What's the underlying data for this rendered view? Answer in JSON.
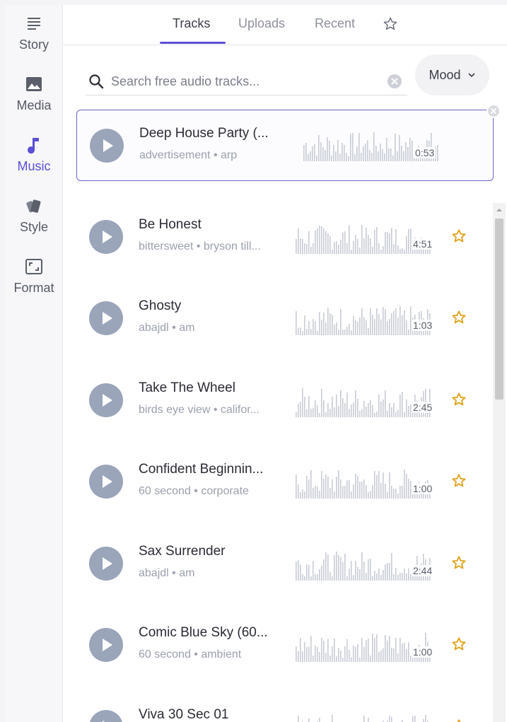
{
  "sidebar": {
    "items": [
      {
        "label": "Story",
        "icon": "menu-lines-icon"
      },
      {
        "label": "Media",
        "icon": "image-icon"
      },
      {
        "label": "Music",
        "icon": "music-note-icon"
      },
      {
        "label": "Style",
        "icon": "style-cards-icon"
      },
      {
        "label": "Format",
        "icon": "aspect-ratio-icon"
      }
    ],
    "active": "Music"
  },
  "tabs": {
    "items": [
      "Tracks",
      "Uploads",
      "Recent"
    ],
    "active": "Tracks",
    "favorites_icon": "star-outline-icon"
  },
  "search": {
    "placeholder": "Search free audio tracks..."
  },
  "mood": {
    "label": "Mood"
  },
  "selected_track": {
    "title": "Deep House Party (...",
    "tags": "advertisement • arp",
    "duration": "0:53"
  },
  "tracks": [
    {
      "title": "Be Honest",
      "tags": "bittersweet • bryson till...",
      "duration": "4:51"
    },
    {
      "title": "Ghosty",
      "tags": "abajdl • am",
      "duration": "1:03"
    },
    {
      "title": "Take The Wheel",
      "tags": "birds eye view • califor...",
      "duration": "2:45"
    },
    {
      "title": "Confident Beginnin...",
      "tags": "60 second • corporate",
      "duration": "1:00"
    },
    {
      "title": "Sax Surrender",
      "tags": "abajdl • am",
      "duration": "2:44"
    },
    {
      "title": "Comic Blue Sky (60...",
      "tags": "60 second • ambient",
      "duration": "1:00"
    },
    {
      "title": "Viva 30 Sec 01",
      "tags": "",
      "duration": ""
    }
  ],
  "colors": {
    "accent": "#5b4fd6",
    "play_button": "#9aa5ba",
    "waveform": "#c8ccd4",
    "star": "#e2a21a"
  }
}
